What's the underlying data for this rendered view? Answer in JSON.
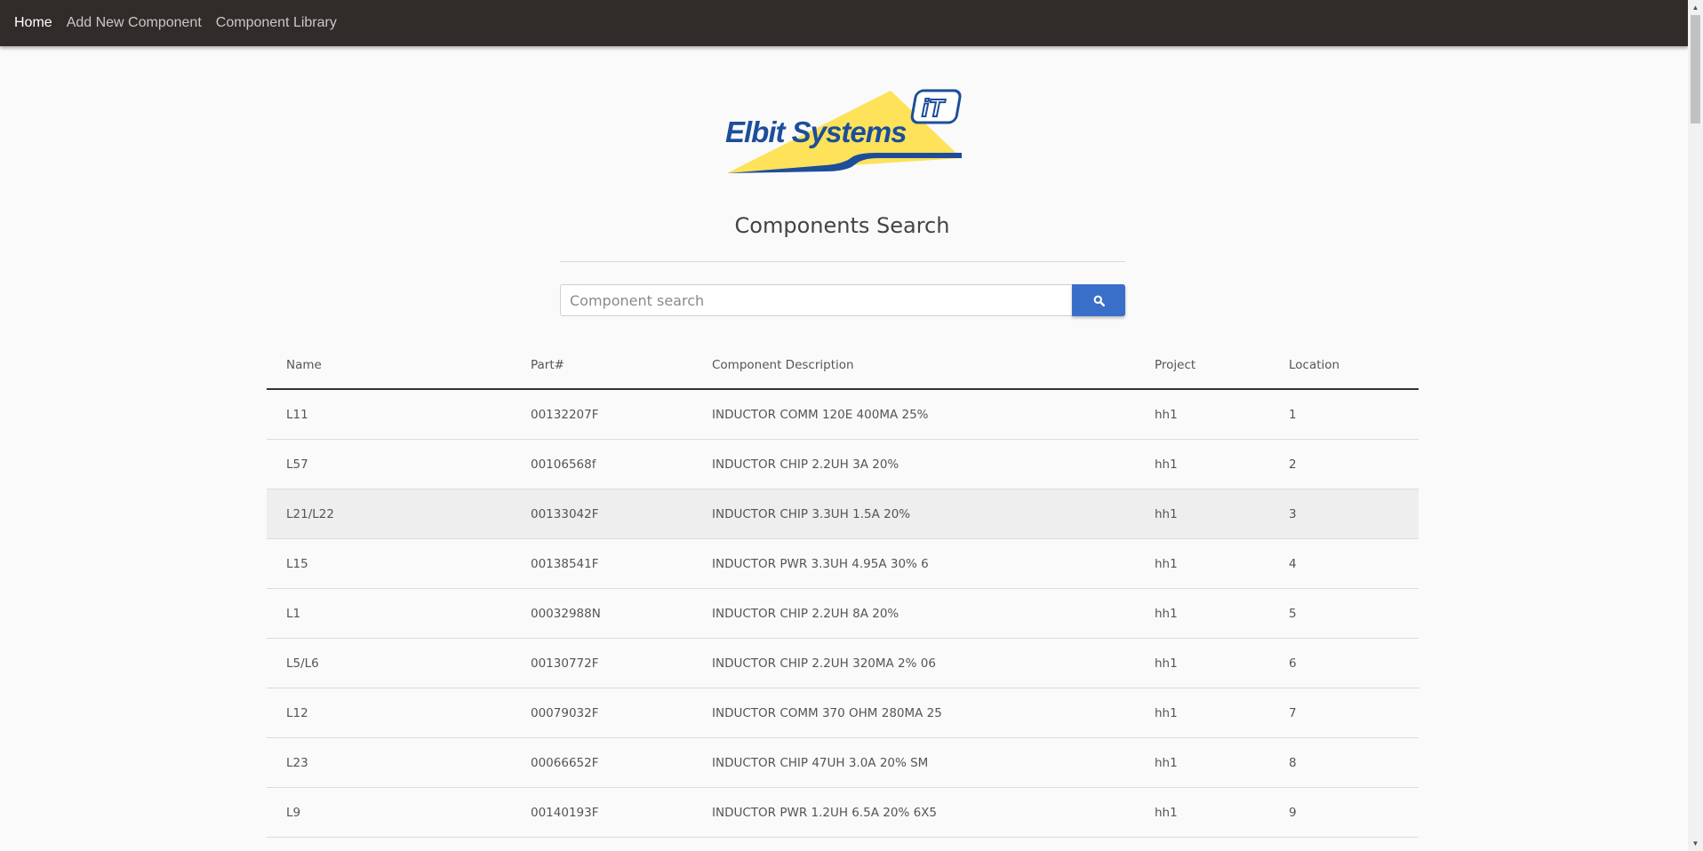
{
  "nav": {
    "items": [
      {
        "label": "Home",
        "active": true
      },
      {
        "label": "Add New Component",
        "active": false
      },
      {
        "label": "Component Library",
        "active": false
      }
    ]
  },
  "logo": {
    "text": "Elbit Systems",
    "badge": "iT"
  },
  "page": {
    "title": "Components Search"
  },
  "search": {
    "placeholder": "Component search",
    "value": "",
    "button_icon": "search-icon"
  },
  "table": {
    "headers": [
      "Name",
      "Part#",
      "Component Description",
      "Project",
      "Location"
    ],
    "rows": [
      [
        "L11",
        "00132207F",
        "INDUCTOR COMM 120E 400MA 25%",
        "hh1",
        "1"
      ],
      [
        "L57",
        "00106568f",
        "INDUCTOR CHIP 2.2UH 3A 20%",
        "hh1",
        "2"
      ],
      [
        "L21/L22",
        "00133042F",
        "INDUCTOR CHIP 3.3UH 1.5A 20%",
        "hh1",
        "3"
      ],
      [
        "L15",
        "00138541F",
        "INDUCTOR PWR 3.3UH 4.95A 30% 6",
        "hh1",
        "4"
      ],
      [
        "L1",
        "00032988N",
        "INDUCTOR CHIP 2.2UH 8A 20%",
        "hh1",
        "5"
      ],
      [
        "L5/L6",
        "00130772F",
        "INDUCTOR CHIP 2.2UH 320MA 2% 06",
        "hh1",
        "6"
      ],
      [
        "L12",
        "00079032F",
        "INDUCTOR COMM 370 OHM 280MA 25",
        "hh1",
        "7"
      ],
      [
        "L23",
        "00066652F",
        "INDUCTOR CHIP 47UH 3.0A 20% SM",
        "hh1",
        "8"
      ],
      [
        "L9",
        "00140193F",
        "INDUCTOR PWR 1.2UH 6.5A 20% 6X5",
        "hh1",
        "9"
      ]
    ]
  },
  "colors": {
    "navbar": "#312c2a",
    "accent": "#3a6fc9",
    "logo_yellow": "#fde25a",
    "logo_blue": "#1d4e9a"
  }
}
